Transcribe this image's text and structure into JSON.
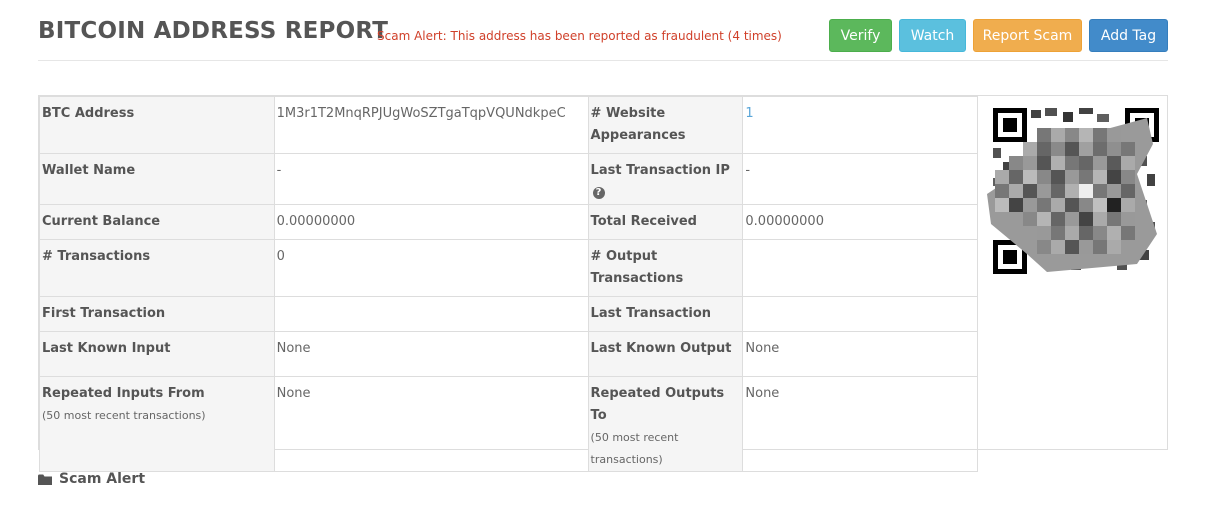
{
  "header": {
    "title": "BITCOIN ADDRESS REPORT",
    "alert": "Scam Alert: This address has been reported as fraudulent (4 times)"
  },
  "buttons": {
    "verify": "Verify",
    "watch": "Watch",
    "report": "Report Scam",
    "tag": "Add Tag"
  },
  "colors": {
    "verify": "#5cb85c",
    "watch": "#5bc0de",
    "report": "#f0ad4e",
    "tag": "#428bca",
    "alert": "#d0402a",
    "link": "#5aa6d8"
  },
  "table": {
    "btc_address_label": "BTC Address",
    "btc_address_value": "1M3r1T2MnqRPJUgWoSZTgaTqpVQUNdkpeC",
    "website_appearances_label": "# Website Appearances",
    "website_appearances_value": "1",
    "wallet_name_label": "Wallet Name",
    "wallet_name_value": "-",
    "last_tx_ip_label": "Last Transaction IP",
    "last_tx_ip_value": "-",
    "current_balance_label": "Current Balance",
    "current_balance_value": "0.00000000",
    "total_received_label": "Total Received",
    "total_received_value": "0.00000000",
    "transactions_label": "# Transactions",
    "transactions_value": "0",
    "output_transactions_label": "# Output Transactions",
    "output_transactions_value": "",
    "first_tx_label": "First Transaction",
    "first_tx_value": "",
    "last_tx_label": "Last Transaction",
    "last_tx_value": "",
    "last_known_input_label": "Last Known Input",
    "last_known_input_value": "None",
    "last_known_output_label": "Last Known Output",
    "last_known_output_value": "None",
    "repeated_inputs_label": "Repeated Inputs From",
    "repeated_inputs_sub": "(50 most recent transactions)",
    "repeated_inputs_value": "None",
    "repeated_outputs_label": "Repeated Outputs To",
    "repeated_outputs_sub": "(50 most recent transactions)",
    "repeated_outputs_value": "None",
    "info_icon": "question-circle-icon"
  },
  "footer": {
    "section_title": "Scam Alert",
    "icon": "folder-icon"
  }
}
